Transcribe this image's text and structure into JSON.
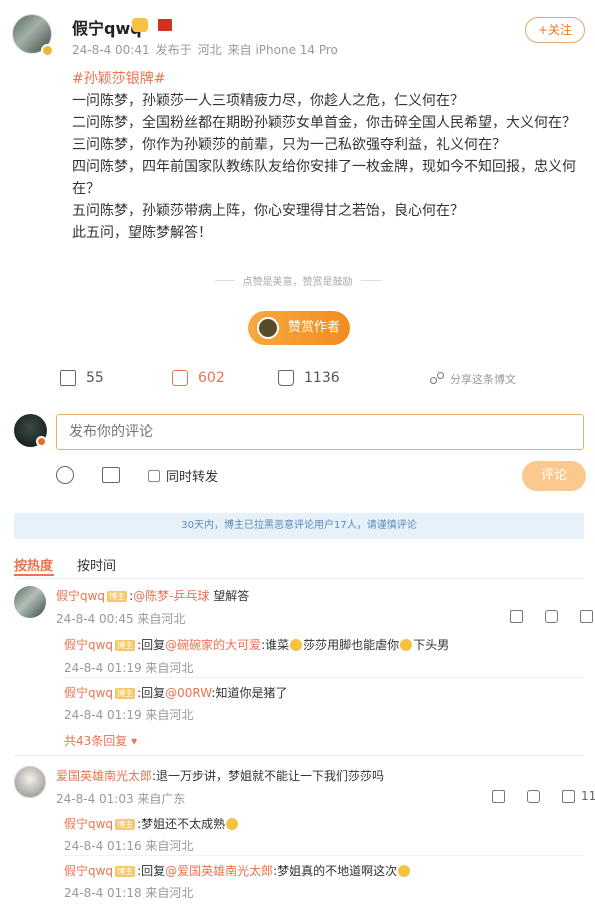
{
  "post": {
    "username": "假宁qwq",
    "date": "24-8-4 00:41",
    "posted_from_label": "发布于",
    "location": "河北",
    "device": "来自 iPhone 14 Pro",
    "follow_label": "+关注",
    "hashtag": "#孙颖莎银牌#",
    "lines": [
      "一问陈梦，孙颖莎一人三项精疲力尽，你趁人之危，仁义何在？",
      "二问陈梦，全国粉丝都在期盼孙颖莎女单首金，你击碎全国人民希望，大义何在？",
      "三问陈梦，你作为孙颖莎的前辈，只为一己私欲强夺利益，礼义何在？",
      "四问陈梦，四年前国家队教练队友给你安排了一枚金牌，现如今不知回报，忠义何在？",
      "五问陈梦，孙颖莎带病上阵，你心安理得甘之若饴，良心何在？",
      "此五问，望陈梦解答！"
    ]
  },
  "reward": {
    "divider_text": "点赞是美意，赞赏是鼓励",
    "button_label": "赞赏作者"
  },
  "actions": {
    "repost_count": "55",
    "comment_count": "602",
    "like_count": "1136",
    "share_label": "分享这条博文"
  },
  "comment_box": {
    "placeholder": "发布你的评论",
    "repost_label": "同时转发",
    "submit_label": "评论"
  },
  "notice": "30天内，博主已拉黑恶意评论用户17人，请谨慎评论",
  "tabs": [
    "按热度",
    "按时间"
  ],
  "comments": {
    "c1": {
      "user": "假宁qwq",
      "tag": "博主",
      "text_prefix": ":",
      "mention": "@陈梦-乒乓球",
      "text": " 望解答",
      "meta": "24-8-4 00:45 来自河北",
      "replies": [
        {
          "user": "假宁qwq",
          "tag": "博主",
          "prefix": ":回复",
          "mention": "@碗碗家的大可爱",
          "text_a": ":谁菜",
          "text_b": "莎莎用脚也能虐你",
          "text_c": "下头男",
          "meta": "24-8-4 01:19 来自河北"
        },
        {
          "user": "假宁qwq",
          "tag": "博主",
          "prefix": ":回复",
          "mention": "@00RW",
          "text": ":知道你是猪了",
          "meta": "24-8-4 01:19 来自河北"
        }
      ],
      "more": "共43条回复"
    },
    "c2": {
      "user": "爱国英雄南光太郎",
      "text": ":退一万步讲，梦姐就不能让一下我们莎莎吗",
      "meta": "24-8-4 01:03 来自广东",
      "like_count": "11",
      "replies": [
        {
          "user": "假宁qwq",
          "tag": "博主",
          "text": ":梦姐还不太成熟",
          "meta": "24-8-4 01:16 来自河北"
        },
        {
          "user": "假宁qwq",
          "tag": "博主",
          "prefix": ":回复",
          "mention": "@爱国英雄南光太郎",
          "text": ":梦姐真的不地道啊这次",
          "meta": "24-8-4 01:18 来自河北"
        }
      ]
    }
  },
  "icons": {
    "repost": "repost-icon",
    "comment": "comment-icon",
    "like": "thumbs-up-icon",
    "share": "share-icon",
    "emoji": "emoji-icon",
    "image": "image-icon"
  },
  "colors": {
    "accent": "#eb7350",
    "follow": "#e07b29",
    "reward": "#f28b22",
    "notice_bg": "#e7f1fa",
    "notice_text": "#5a8bb8"
  }
}
